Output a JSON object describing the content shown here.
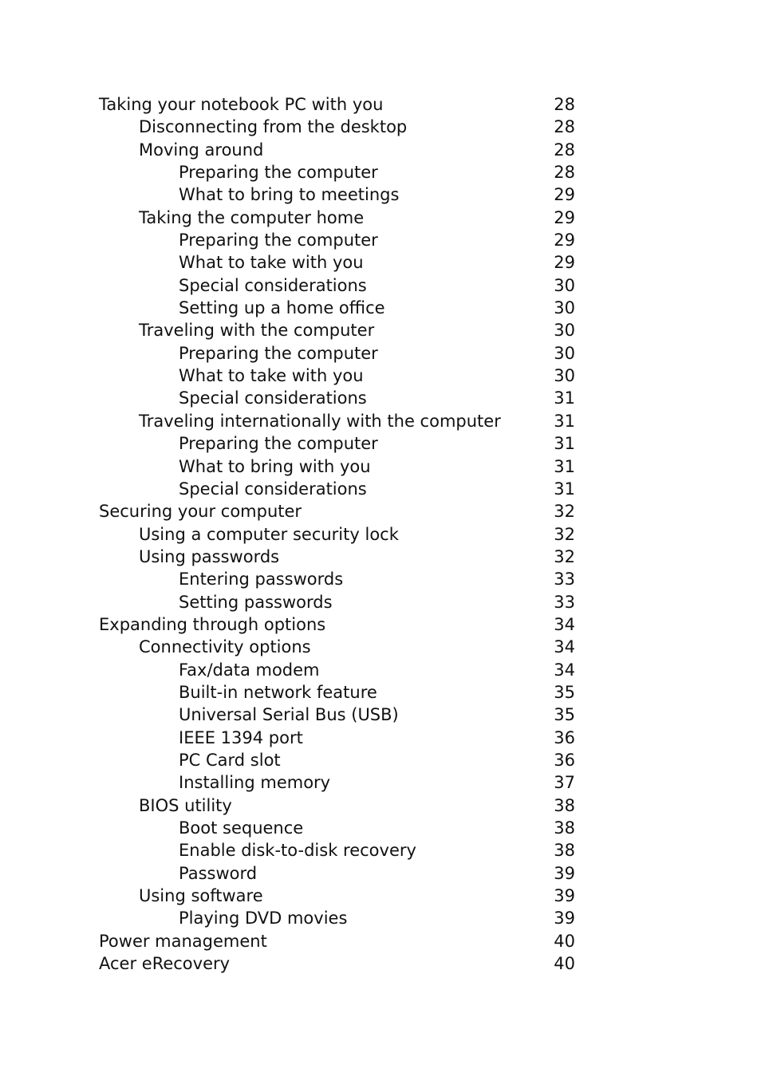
{
  "toc": {
    "entries": [
      {
        "level": 1,
        "title": "Taking your notebook PC with you",
        "page": "28"
      },
      {
        "level": 2,
        "title": "Disconnecting from the desktop",
        "page": "28"
      },
      {
        "level": 2,
        "title": "Moving around",
        "page": "28"
      },
      {
        "level": 3,
        "title": "Preparing the computer",
        "page": "28"
      },
      {
        "level": 3,
        "title": "What to bring to meetings",
        "page": "29"
      },
      {
        "level": 2,
        "title": "Taking the computer home",
        "page": "29"
      },
      {
        "level": 3,
        "title": "Preparing the computer",
        "page": "29"
      },
      {
        "level": 3,
        "title": "What to take with you",
        "page": "29"
      },
      {
        "level": 3,
        "title": "Special considerations",
        "page": "30"
      },
      {
        "level": 3,
        "title": "Setting up a home office",
        "page": "30"
      },
      {
        "level": 2,
        "title": "Traveling with the computer",
        "page": "30"
      },
      {
        "level": 3,
        "title": "Preparing the computer",
        "page": "30"
      },
      {
        "level": 3,
        "title": "What to take with you",
        "page": "30"
      },
      {
        "level": 3,
        "title": "Special considerations",
        "page": "31"
      },
      {
        "level": 2,
        "title": "Traveling internationally with the computer",
        "page": "31"
      },
      {
        "level": 3,
        "title": "Preparing the computer",
        "page": "31"
      },
      {
        "level": 3,
        "title": "What to bring with you",
        "page": "31"
      },
      {
        "level": 3,
        "title": "Special considerations",
        "page": "31"
      },
      {
        "level": 1,
        "title": "Securing your computer",
        "page": "32"
      },
      {
        "level": 2,
        "title": "Using a computer security lock",
        "page": "32"
      },
      {
        "level": 2,
        "title": "Using passwords",
        "page": "32"
      },
      {
        "level": 3,
        "title": "Entering passwords",
        "page": "33"
      },
      {
        "level": 3,
        "title": "Setting passwords",
        "page": "33"
      },
      {
        "level": 1,
        "title": "Expanding through options",
        "page": "34"
      },
      {
        "level": 2,
        "title": "Connectivity options",
        "page": "34"
      },
      {
        "level": 3,
        "title": "Fax/data modem",
        "page": "34"
      },
      {
        "level": 3,
        "title": "Built-in network feature",
        "page": "35"
      },
      {
        "level": 3,
        "title": "Universal Serial Bus (USB)",
        "page": "35"
      },
      {
        "level": 3,
        "title": "IEEE 1394 port",
        "page": "36"
      },
      {
        "level": 3,
        "title": "PC Card slot",
        "page": "36"
      },
      {
        "level": 3,
        "title": "Installing memory",
        "page": "37"
      },
      {
        "level": 2,
        "title": "BIOS utility",
        "page": "38"
      },
      {
        "level": 3,
        "title": "Boot sequence",
        "page": "38"
      },
      {
        "level": 3,
        "title": "Enable disk-to-disk recovery",
        "page": "38"
      },
      {
        "level": 3,
        "title": "Password",
        "page": "39"
      },
      {
        "level": 2,
        "title": "Using software",
        "page": "39"
      },
      {
        "level": 3,
        "title": "Playing DVD movies",
        "page": "39"
      },
      {
        "level": 1,
        "title": "Power management",
        "page": "40"
      },
      {
        "level": 1,
        "title": "Acer eRecovery",
        "page": "40"
      }
    ]
  }
}
